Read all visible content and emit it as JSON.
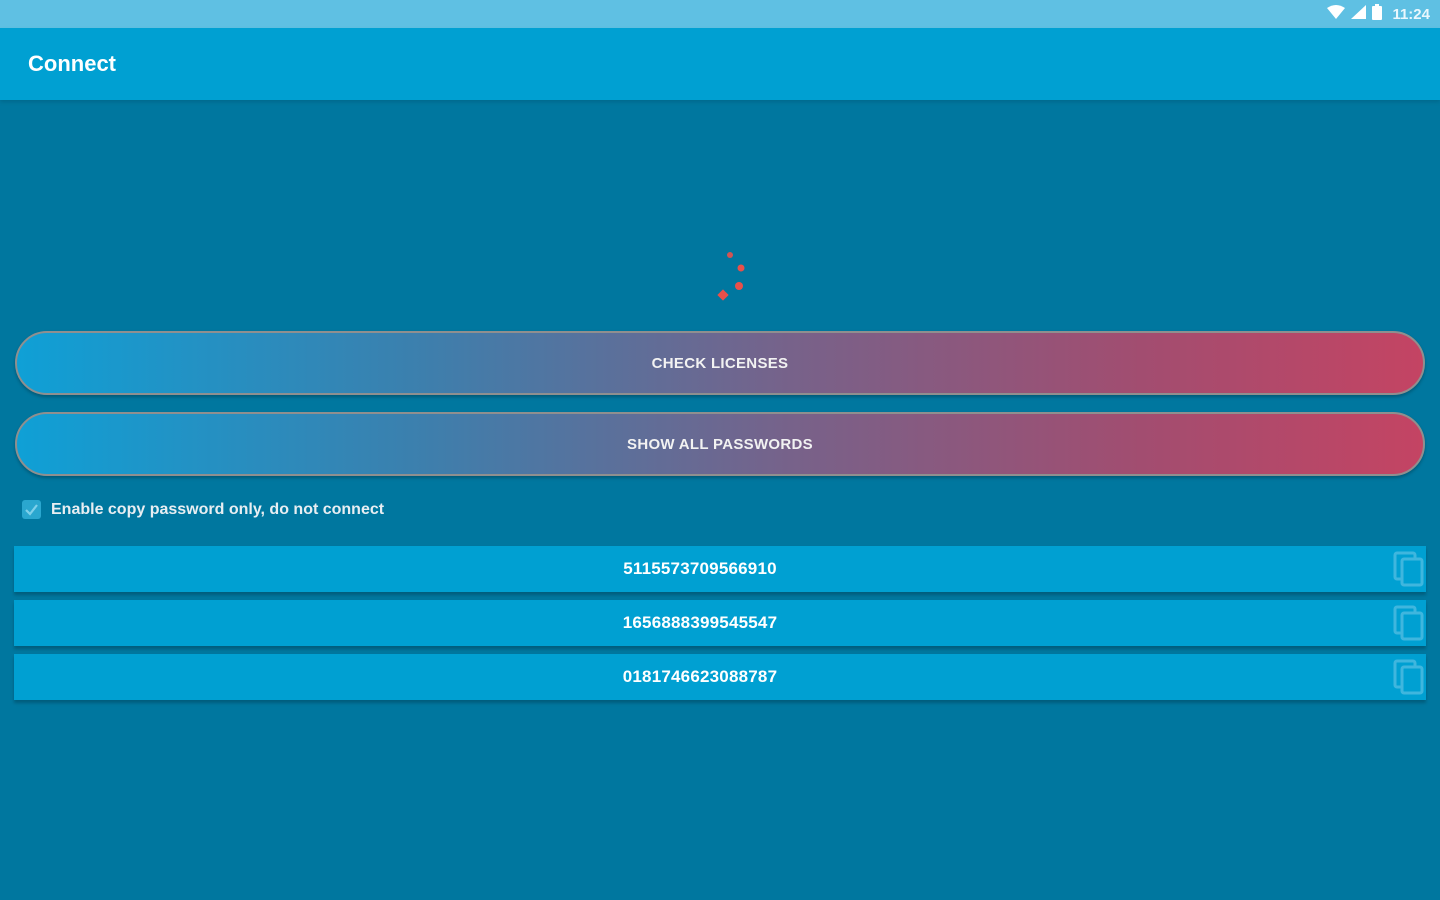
{
  "status_bar": {
    "time": "11:24",
    "icons": [
      "wifi-icon",
      "signal-icon",
      "battery-icon"
    ]
  },
  "app_bar": {
    "title": "Connect"
  },
  "buttons": {
    "check_licenses": "CHECK LICENSES",
    "show_all_passwords": "SHOW ALL PASSWORDS"
  },
  "option": {
    "label": "Enable copy password only, do not connect",
    "checked": true
  },
  "passwords": [
    {
      "value": "5115573709566910"
    },
    {
      "value": "1656888399545547"
    },
    {
      "value": "0181746623088787"
    }
  ],
  "colors": {
    "background": "#00779f",
    "app_bar": "#00a0d2",
    "status_bar": "#5fc0e3",
    "spinner": "#e8504a",
    "gradient_start": "#0fa0d6",
    "gradient_end": "#c44463"
  }
}
